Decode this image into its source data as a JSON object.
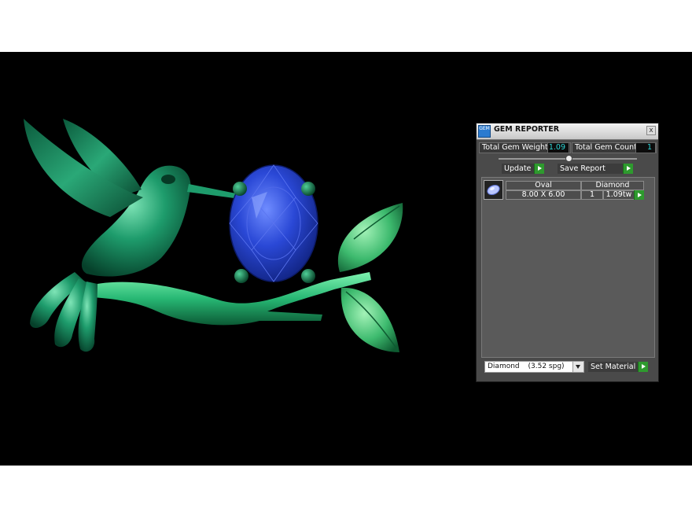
{
  "panel": {
    "title": "GEM REPORTER",
    "logo_text": "GEM",
    "close_glyph": "x",
    "total_weight_label": "Total Gem Weight",
    "total_weight_value": "1.09",
    "total_count_label": "Total Gem Count",
    "total_count_value": "1",
    "update_label": "Update",
    "save_report_label": "Save Report",
    "table": {
      "headers": [
        "Oval",
        "Diamond"
      ],
      "row": {
        "size": "8.00 X 6.00",
        "count": "1",
        "weight": "1.09tw"
      }
    },
    "material_select": {
      "value": "Diamond",
      "spg": "(3.52 spg)"
    },
    "set_material_label": "Set Material"
  },
  "colors": {
    "viewport_bg": "#000000",
    "jewel_green": "#1f9a6c",
    "stone_blue": "#1f3cc4",
    "value_text": "#2fd6d6",
    "play_green": "#2e9a2e"
  },
  "icons": [
    "close-icon",
    "play-icon",
    "gem-thumbnail-icon",
    "chevron-down-icon",
    "slider-knob"
  ]
}
